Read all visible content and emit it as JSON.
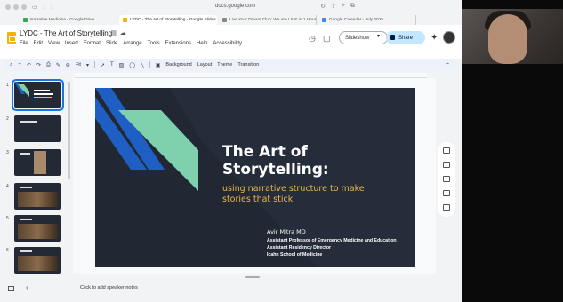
{
  "browser": {
    "url": "docs.google.com",
    "tabs": [
      {
        "label": "Narrative Medicine - Google Drive",
        "color": "#34a853",
        "active": false
      },
      {
        "label": "LYDC - The Art of Storytelling - Google Slides",
        "color": "#f4b400",
        "active": true
      },
      {
        "label": "Live Your Dream Club: We are LIVE in 1 Hour! 🚀 Join Us! -",
        "color": "#888888",
        "active": false
      },
      {
        "label": "Google Calendar - July 2025",
        "color": "#4285f4",
        "active": false
      }
    ]
  },
  "app": {
    "doc_title": "LYDC - The Art of Storytelling",
    "menu": [
      "File",
      "Edit",
      "View",
      "Insert",
      "Format",
      "Slide",
      "Arrange",
      "Tools",
      "Extensions",
      "Help",
      "Accessibility"
    ],
    "slideshow_label": "Slideshow",
    "share_label": "Share"
  },
  "toolbar": {
    "zoom": "Fit",
    "background": "Background",
    "layout": "Layout",
    "theme": "Theme",
    "transition": "Transition"
  },
  "filmstrip": [
    "1",
    "2",
    "3",
    "4",
    "5",
    "6"
  ],
  "slide": {
    "title_line1": "The Art of",
    "title_line2": "Storytelling:",
    "subtitle_line1": "using narrative structure to make",
    "subtitle_line2": "stories that stick",
    "author": "Avir Mitra MD",
    "role1": "Assistant Professor of Emergency Medicine and Education",
    "role2": "Assistant Residency Director",
    "affiliation": "Icahn School of Medicine"
  },
  "notes": {
    "placeholder": "Click to add speaker notes"
  },
  "colors": {
    "slide_bg": "#212834",
    "accent_blue": "#1f5fc4",
    "accent_mint": "#7fd1ae",
    "accent_gold": "#f0b64a",
    "share_bg": "#c2e7ff"
  }
}
